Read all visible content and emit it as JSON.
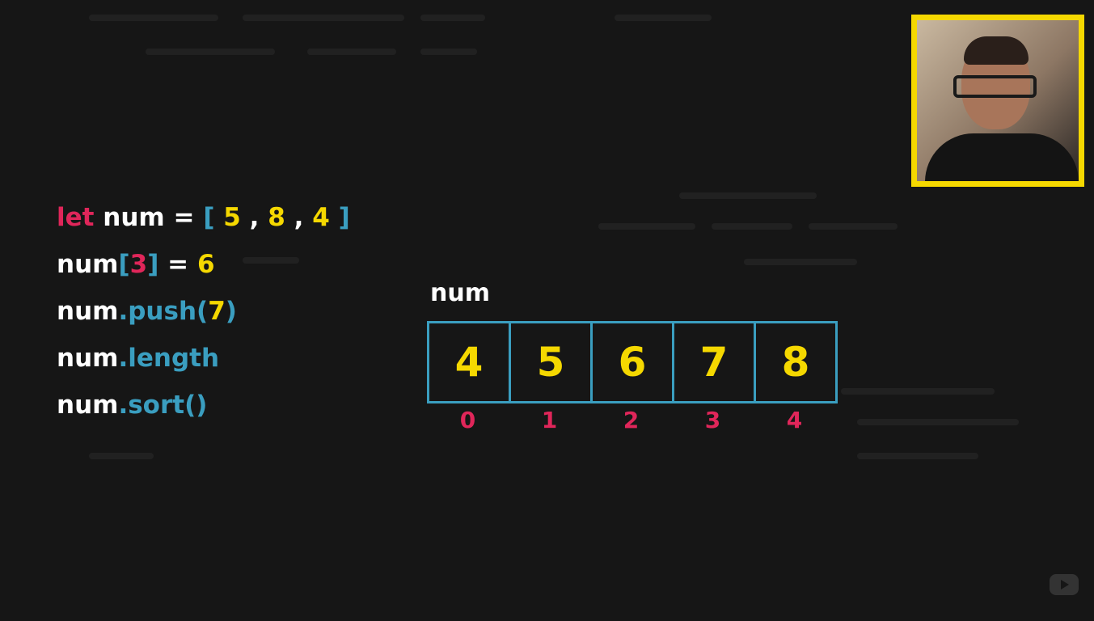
{
  "code_lines": {
    "line1": {
      "keyword": "let",
      "name": "num",
      "eq": "=",
      "open": "[",
      "v1": "5",
      "c1": ",",
      "v2": "8",
      "c2": ",",
      "v3": "4",
      "close": "]"
    },
    "line2": {
      "name": "num",
      "open": "[",
      "index": "3",
      "close": "]",
      "eq": "=",
      "value": "6"
    },
    "line3": {
      "name": "num",
      "method": ".push(",
      "arg": "7",
      "close": ")"
    },
    "line4": {
      "name": "num",
      "prop": ".length"
    },
    "line5": {
      "name": "num",
      "method": ".sort()"
    }
  },
  "array": {
    "label": "num",
    "values": [
      "4",
      "5",
      "6",
      "7",
      "8"
    ],
    "indices": [
      "0",
      "1",
      "2",
      "3",
      "4"
    ]
  },
  "colors": {
    "keyword": "#e0265a",
    "value": "#f5d800",
    "punct": "#3a9ec0",
    "frame": "#f5d800"
  }
}
